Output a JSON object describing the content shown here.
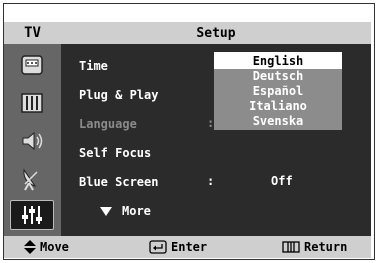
{
  "header": {
    "tv_label": "TV",
    "title": "Setup"
  },
  "menu": {
    "items": [
      {
        "label": "Time",
        "colon": "",
        "value": ""
      },
      {
        "label": "Plug & Play",
        "colon": "",
        "value": ""
      },
      {
        "label": "Language",
        "colon": ":",
        "value": ""
      },
      {
        "label": "Self Focus",
        "colon": "",
        "value": ""
      },
      {
        "label": "Blue Screen",
        "colon": ":",
        "value": "Off"
      }
    ],
    "more_label": "More"
  },
  "language_dropdown": {
    "options": [
      "English",
      "Deutsch",
      "Español",
      "Italiano",
      "Svenska"
    ],
    "selected": "English"
  },
  "sidebar_icons": [
    "clock-icon",
    "film-icon",
    "speaker-icon",
    "satellite-icon",
    "settings-sliders-icon"
  ],
  "footer": {
    "move": "Move",
    "enter": "Enter",
    "return": "Return"
  },
  "colors": {
    "background": "#2b2b2b",
    "sidebar": "#666666",
    "bar": "#cfcfcf",
    "text": "#ffffff",
    "dim": "#8a8a8a"
  }
}
